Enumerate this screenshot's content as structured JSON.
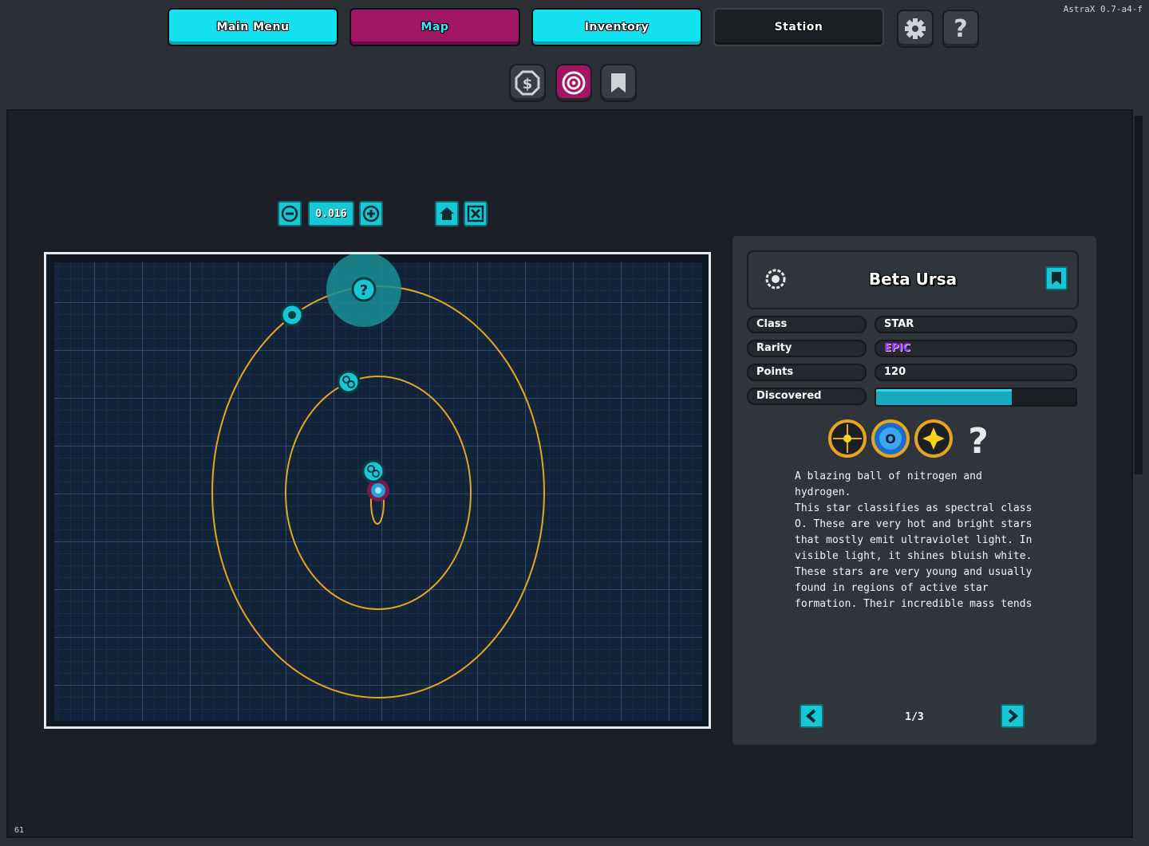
{
  "version": "AstraX 0.7-a4-f",
  "fps": "61",
  "tabs": [
    {
      "label": "Main Menu",
      "state": "cyan"
    },
    {
      "label": "Map",
      "state": "active"
    },
    {
      "label": "Inventory",
      "state": "cyan"
    },
    {
      "label": "Station",
      "state": "dark"
    }
  ],
  "top_buttons": {
    "settings_icon": "gear-icon",
    "help_label": "?"
  },
  "sub_buttons": [
    "currency-icon",
    "target-icon",
    "bookmark-icon"
  ],
  "zoom": {
    "value": "0.016"
  },
  "info": {
    "name": "Beta Ursa",
    "rows": [
      {
        "label": "Class",
        "value": "STAR"
      },
      {
        "label": "Rarity",
        "value": "EPIC"
      },
      {
        "label": "Points",
        "value": "120"
      }
    ],
    "discovered_label": "Discovered",
    "discovered_fraction": 0.68,
    "badge_unknown": "?",
    "badge_o_letter": "O",
    "description": "A blazing ball of nitrogen and hydrogen.\nThis star classifies as spectral class O. These are very hot and bright stars that mostly emit ultraviolet light. In visible light, it shines bluish white. These stars are very young and usually found in regions of active star formation. Their incredible mass tends",
    "page": "1/3"
  },
  "colors": {
    "accent_cyan": "#14e1f0",
    "accent_magenta": "#a01564",
    "orbit": "#e6a521",
    "epic": "#9b2cff"
  }
}
